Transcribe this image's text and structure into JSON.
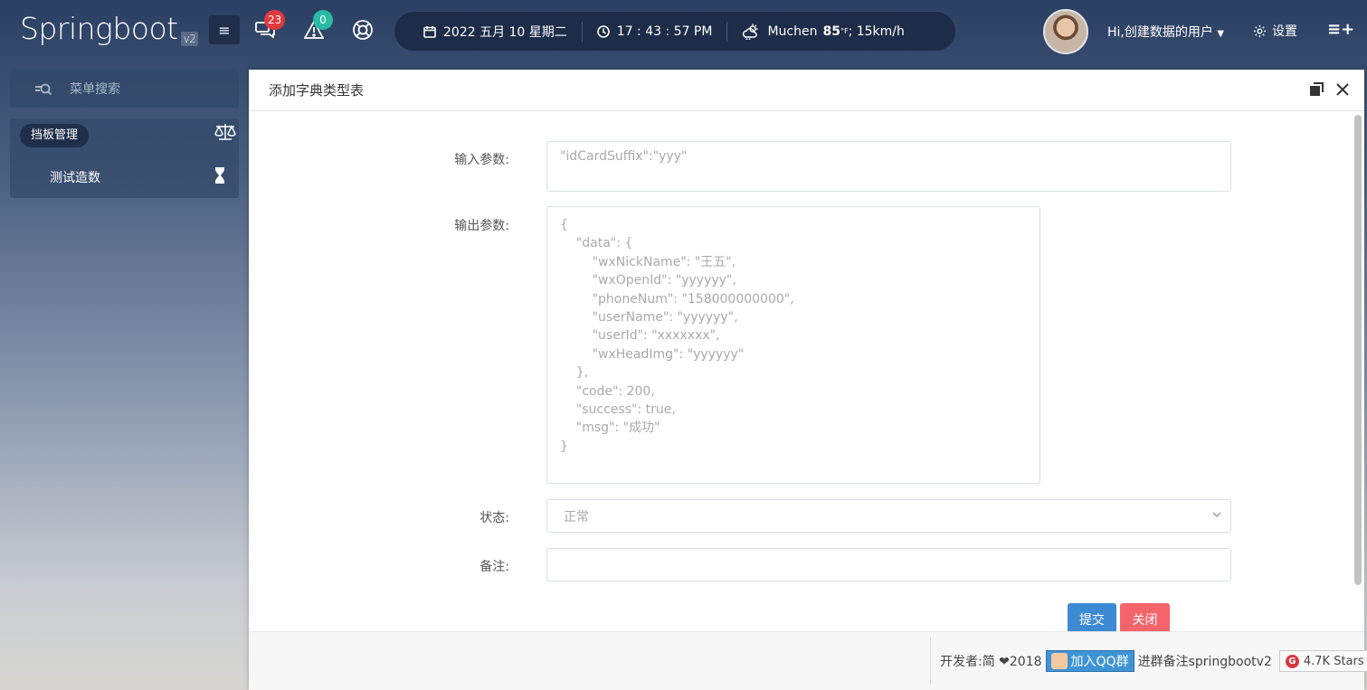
{
  "brand": {
    "name": "Springboot",
    "version": "v2"
  },
  "topbar": {
    "messages_count": "23",
    "alerts_count": "0",
    "date": "2022 五月 10 星期二",
    "time": "17 : 43 : 57 PM",
    "weather_city": "Muchen",
    "weather_temp": "85",
    "weather_unit": "°F",
    "weather_wind": " ; 15km/h",
    "user_greeting": "Hi,创建数据的用户",
    "settings_label": "设置"
  },
  "sidebar": {
    "search_placeholder": "菜单搜索",
    "group_label": "挡板管理",
    "items": [
      {
        "label": "测试造数"
      }
    ]
  },
  "modal": {
    "title": "添加字典类型表",
    "fields": {
      "input_label": "输入参数:",
      "input_value": "\"idCardSuffix\":\"yyy\"",
      "output_label": "输出参数:",
      "output_value": "{\n    \"data\": {\n        \"wxNickName\": \"王五\",\n        \"wxOpenId\": \"yyyyyy\",\n        \"phoneNum\": \"158000000000\",\n        \"userName\": \"yyyyyy\",\n        \"userId\": \"xxxxxxx\",\n        \"wxHeadImg\": \"yyyyyy\"\n    },\n    \"code\": 200,\n    \"success\": true,\n    \"msg\": \"成功\"\n}",
      "status_label": "状态:",
      "status_value": "正常",
      "remark_label": "备注:",
      "remark_value": ""
    },
    "submit_label": "提交",
    "close_label": "关闭"
  },
  "footer": {
    "developer": "开发者:简 ❤2018",
    "qq_label": "加入QQ群",
    "join_note": "进群备注springbootv2",
    "stars_label": "4.7K Stars",
    "stars_icon_letter": "G"
  },
  "colors": {
    "accent_blue": "#3c8ad2",
    "danger_red": "#f5636b",
    "badge_red": "#e0393e",
    "badge_teal": "#2bbba3",
    "topbar_dark": "#1d2c48"
  }
}
